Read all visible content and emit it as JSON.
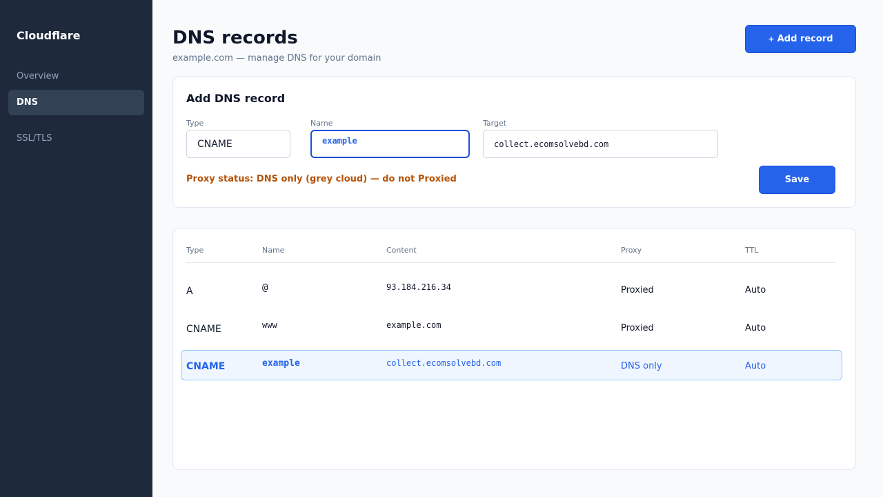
{
  "sidebar": {
    "brand": "Cloudflare",
    "items": [
      {
        "label": "Overview"
      },
      {
        "label": "DNS"
      },
      {
        "label": "SSL/TLS"
      }
    ]
  },
  "header": {
    "title": "DNS records",
    "subtitle": "example.com — manage DNS for your domain",
    "add_button": {
      "icon": "+",
      "label": "Add record"
    }
  },
  "form": {
    "title": "Add DNS record",
    "type": {
      "label": "Type",
      "value": "CNAME"
    },
    "name": {
      "label": "Name",
      "value": "example"
    },
    "target": {
      "label": "Target",
      "value": "collect.ecomsolvebd.com"
    },
    "warning": "Proxy status: DNS only (grey cloud) — do not Proxied",
    "save_label": "Save"
  },
  "table": {
    "columns": [
      "Type",
      "Name",
      "Content",
      "Proxy",
      "TTL"
    ],
    "rows": [
      {
        "type": "A",
        "name": "@",
        "content": "93.184.216.34",
        "proxy": "Proxied",
        "ttl": "Auto"
      },
      {
        "type": "CNAME",
        "name": "www",
        "content": "example.com",
        "proxy": "Proxied",
        "ttl": "Auto"
      },
      {
        "type": "CNAME",
        "name": "example",
        "content": "collect.ecomsolvebd.com",
        "proxy": "DNS only",
        "ttl": "Auto"
      }
    ]
  },
  "colors": {
    "sidebar_bg": "#1e293b",
    "accent": "#2563eb",
    "warning": "#b45309",
    "highlight_bg": "#eff6ff"
  }
}
